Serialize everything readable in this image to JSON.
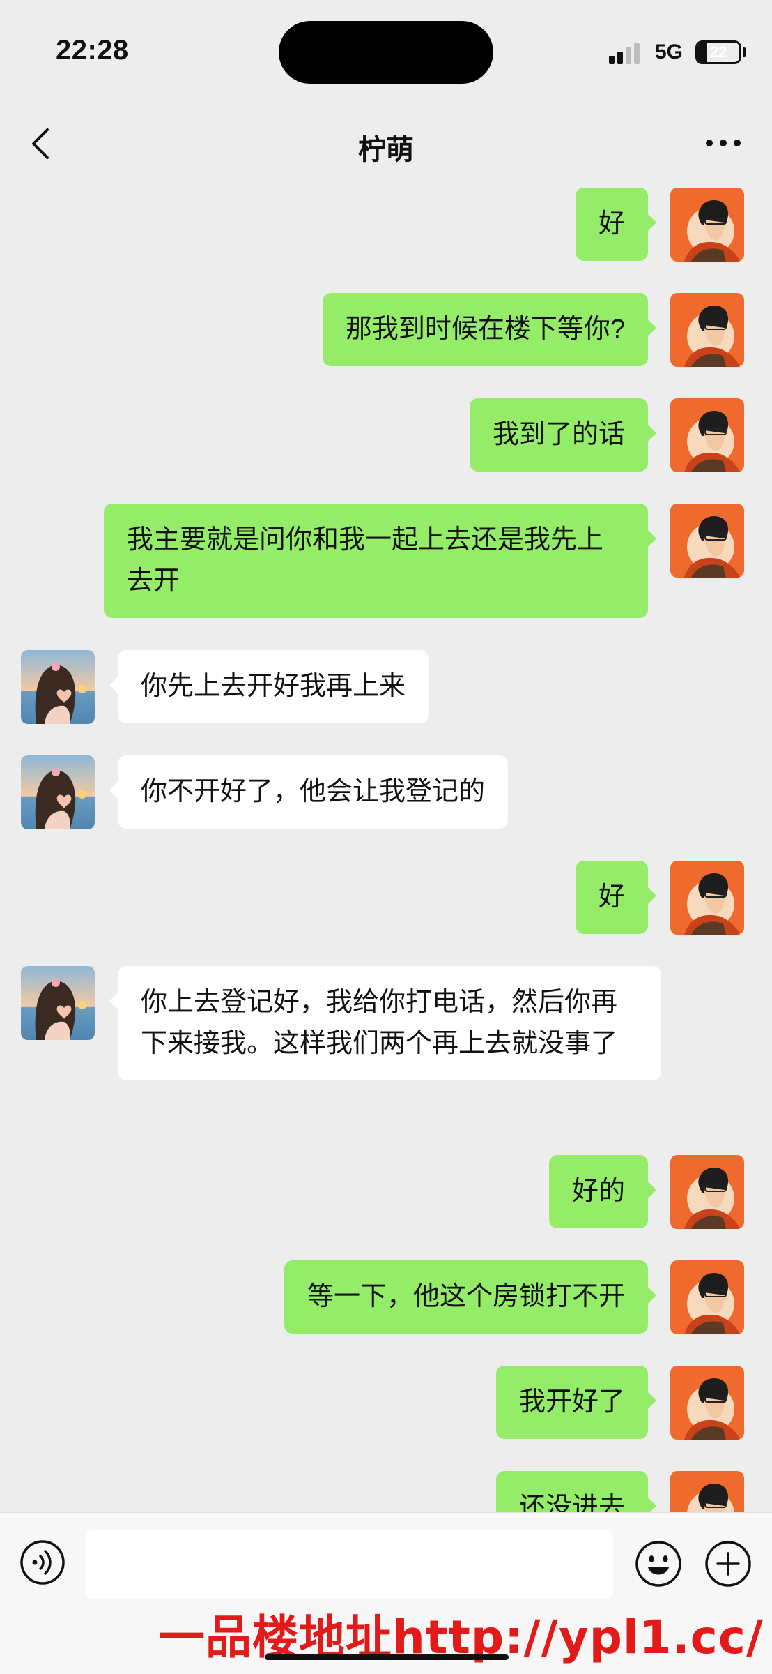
{
  "status_bar": {
    "time": "22:28",
    "network": "5G",
    "battery": "22",
    "battery_level_percent": 22
  },
  "header": {
    "title": "柠萌",
    "back_icon": "chevron-left-icon",
    "more_icon": "ellipsis-icon"
  },
  "messages": [
    {
      "sender": "me",
      "text": "好"
    },
    {
      "sender": "me",
      "text": "那我到时候在楼下等你?"
    },
    {
      "sender": "me",
      "text": "我到了的话"
    },
    {
      "sender": "me",
      "text": "我主要就是问你和我一起上去还是我先上去开"
    },
    {
      "sender": "other",
      "text": "你先上去开好我再上来"
    },
    {
      "sender": "other",
      "text": "你不开好了，他会让我登记的"
    },
    {
      "sender": "me",
      "text": "好"
    },
    {
      "sender": "other",
      "text": "你上去登记好，我给你打电话，然后你再下来接我。这样我们两个再上去就没事了"
    },
    {
      "sender": "me",
      "text": "好的"
    },
    {
      "sender": "me",
      "text": "等一下，他这个房锁打不开"
    },
    {
      "sender": "me",
      "text": "我开好了"
    },
    {
      "sender": "me",
      "text": "还没进去"
    }
  ],
  "input_bar": {
    "value": "",
    "voice_icon": "voice-icon",
    "emoji_icon": "emoji-icon",
    "plus_icon": "plus-circle-icon"
  },
  "watermark": "一品楼地址http://ypl1.cc/",
  "colors": {
    "outgoing_bubble": "#95ec69",
    "incoming_bubble": "#ffffff",
    "background": "#ededed",
    "watermark": "#e21a1a"
  }
}
